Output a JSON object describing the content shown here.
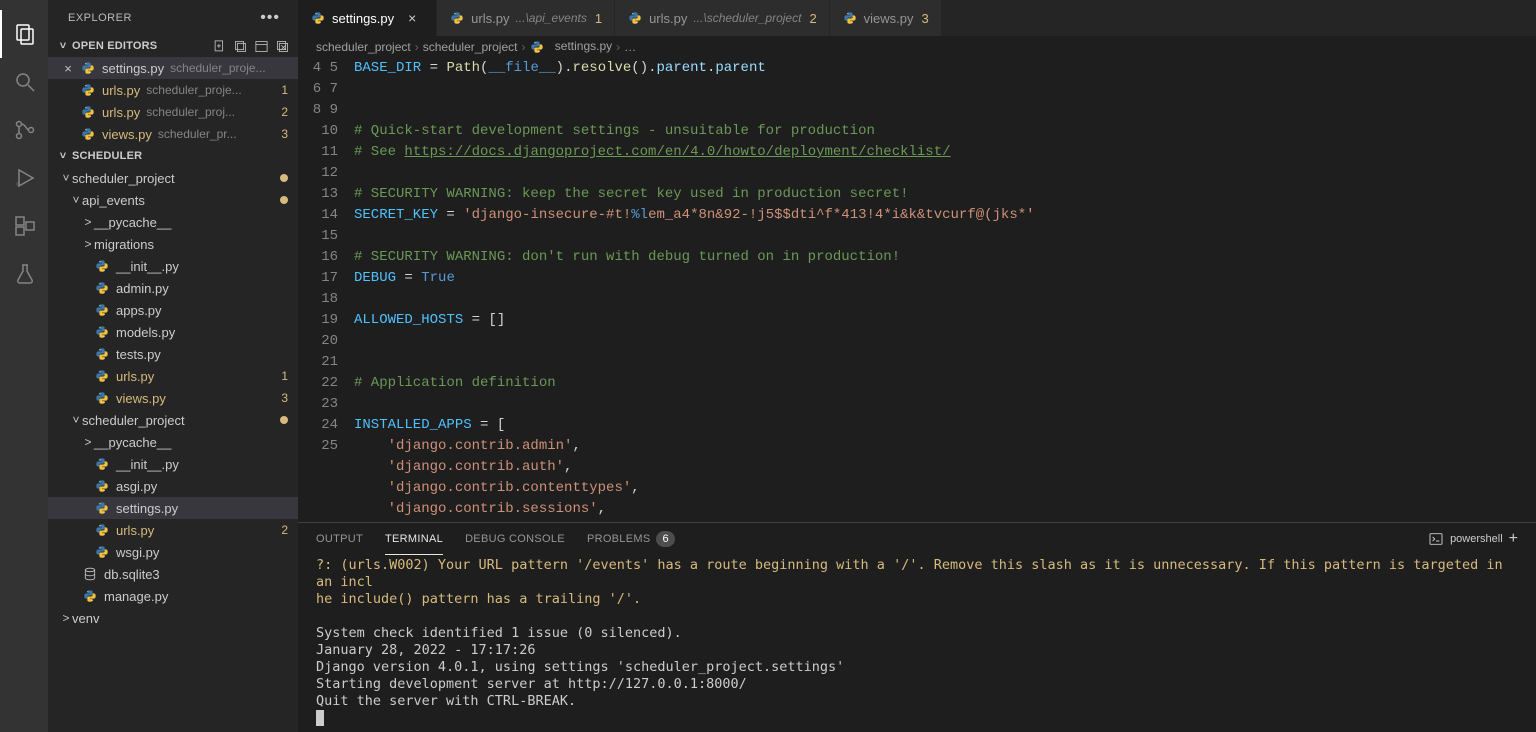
{
  "activitybar": {
    "items": [
      "files",
      "search",
      "git",
      "debug",
      "extensions",
      "testing"
    ]
  },
  "explorer": {
    "title": "EXPLORER",
    "openEditorsLabel": "OPEN EDITORS",
    "openEditors": [
      {
        "name": "settings.py",
        "hint": "scheduler_proje...",
        "badge": "",
        "active": true
      },
      {
        "name": "urls.py",
        "hint": "scheduler_proje...",
        "badge": "1",
        "active": false
      },
      {
        "name": "urls.py",
        "hint": "scheduler_proj...",
        "badge": "2",
        "active": false
      },
      {
        "name": "views.py",
        "hint": "scheduler_pr...",
        "badge": "3",
        "active": false
      }
    ],
    "workspaceLabel": "SCHEDULER",
    "tree": [
      {
        "d": 0,
        "twist": "˅",
        "name": "scheduler_project",
        "type": "folder",
        "dot": true
      },
      {
        "d": 1,
        "twist": "˅",
        "name": "api_events",
        "type": "folder",
        "dot": true
      },
      {
        "d": 2,
        "twist": ">",
        "name": "__pycache__",
        "type": "folder"
      },
      {
        "d": 2,
        "twist": ">",
        "name": "migrations",
        "type": "folder"
      },
      {
        "d": 2,
        "name": "__init__.py",
        "type": "py"
      },
      {
        "d": 2,
        "name": "admin.py",
        "type": "py"
      },
      {
        "d": 2,
        "name": "apps.py",
        "type": "py"
      },
      {
        "d": 2,
        "name": "models.py",
        "type": "py"
      },
      {
        "d": 2,
        "name": "tests.py",
        "type": "py"
      },
      {
        "d": 2,
        "name": "urls.py",
        "type": "py",
        "mod": true,
        "num": "1"
      },
      {
        "d": 2,
        "name": "views.py",
        "type": "py",
        "mod": true,
        "num": "3"
      },
      {
        "d": 1,
        "twist": "˅",
        "name": "scheduler_project",
        "type": "folder",
        "dot": true
      },
      {
        "d": 2,
        "twist": ">",
        "name": "__pycache__",
        "type": "folder"
      },
      {
        "d": 2,
        "name": "__init__.py",
        "type": "py"
      },
      {
        "d": 2,
        "name": "asgi.py",
        "type": "py"
      },
      {
        "d": 2,
        "name": "settings.py",
        "type": "py",
        "sel": true
      },
      {
        "d": 2,
        "name": "urls.py",
        "type": "py",
        "mod": true,
        "num": "2"
      },
      {
        "d": 2,
        "name": "wsgi.py",
        "type": "py"
      },
      {
        "d": 1,
        "name": "db.sqlite3",
        "type": "db"
      },
      {
        "d": 1,
        "name": "manage.py",
        "type": "py"
      },
      {
        "d": 0,
        "twist": ">",
        "name": "venv",
        "type": "folder"
      }
    ]
  },
  "tabs": [
    {
      "name": "settings.py",
      "active": true,
      "close": true
    },
    {
      "name": "urls.py",
      "hint": "...\\api_events",
      "num": "1"
    },
    {
      "name": "urls.py",
      "hint": "...\\scheduler_project",
      "num": "2"
    },
    {
      "name": "views.py",
      "num": "3"
    }
  ],
  "breadcrumb": [
    "scheduler_project",
    "scheduler_project",
    "settings.py",
    "…"
  ],
  "code": {
    "start": 4,
    "lines": [
      {
        "n": 4,
        "seg": [
          [
            "var",
            "BASE_DIR"
          ],
          [
            "op",
            " = "
          ],
          [
            "func",
            "Path"
          ],
          [
            "op",
            "("
          ],
          [
            "const",
            "__file__"
          ],
          [
            "op",
            ")."
          ],
          [
            "func",
            "resolve"
          ],
          [
            "op",
            "()."
          ],
          [
            "prop",
            "parent"
          ],
          [
            "op",
            "."
          ],
          [
            "prop",
            "parent"
          ]
        ]
      },
      {
        "n": 5,
        "seg": []
      },
      {
        "n": 6,
        "seg": []
      },
      {
        "n": 7,
        "seg": [
          [
            "cmt",
            "# Quick-start development settings - unsuitable for production"
          ]
        ]
      },
      {
        "n": 8,
        "seg": [
          [
            "cmt",
            "# See "
          ],
          [
            "link",
            "https://docs.djangoproject.com/en/4.0/howto/deployment/checklist/"
          ]
        ]
      },
      {
        "n": 9,
        "seg": []
      },
      {
        "n": 10,
        "seg": [
          [
            "cmt",
            "# SECURITY WARNING: keep the secret key used in production secret!"
          ]
        ]
      },
      {
        "n": 11,
        "seg": [
          [
            "var",
            "SECRET_KEY"
          ],
          [
            "op",
            " = "
          ],
          [
            "str",
            "'django-insecure-#t!"
          ],
          [
            "esc",
            "%l"
          ],
          [
            "str",
            "em_a4*8n&92-!j5$$dti^f*413!4*i&k&tvcurf@(jks*'"
          ]
        ]
      },
      {
        "n": 12,
        "seg": []
      },
      {
        "n": 13,
        "seg": [
          [
            "cmt",
            "# SECURITY WARNING: don't run with debug turned on in production!"
          ]
        ]
      },
      {
        "n": 14,
        "seg": [
          [
            "var",
            "DEBUG"
          ],
          [
            "op",
            " = "
          ],
          [
            "const",
            "True"
          ]
        ]
      },
      {
        "n": 15,
        "seg": []
      },
      {
        "n": 16,
        "seg": [
          [
            "var",
            "ALLOWED_HOSTS"
          ],
          [
            "op",
            " = []"
          ]
        ]
      },
      {
        "n": 17,
        "seg": []
      },
      {
        "n": 18,
        "seg": []
      },
      {
        "n": 19,
        "seg": [
          [
            "cmt",
            "# Application definition"
          ]
        ]
      },
      {
        "n": 20,
        "seg": []
      },
      {
        "n": 21,
        "seg": [
          [
            "var",
            "INSTALLED_APPS"
          ],
          [
            "op",
            " = ["
          ]
        ]
      },
      {
        "n": 22,
        "seg": [
          [
            "op",
            "    "
          ],
          [
            "str",
            "'django.contrib.admin'"
          ],
          [
            "op",
            ","
          ]
        ]
      },
      {
        "n": 23,
        "seg": [
          [
            "op",
            "    "
          ],
          [
            "str",
            "'django.contrib.auth'"
          ],
          [
            "op",
            ","
          ]
        ]
      },
      {
        "n": 24,
        "seg": [
          [
            "op",
            "    "
          ],
          [
            "str",
            "'django.contrib.contenttypes'"
          ],
          [
            "op",
            ","
          ]
        ]
      },
      {
        "n": 25,
        "seg": [
          [
            "op",
            "    "
          ],
          [
            "str",
            "'django.contrib.sessions'"
          ],
          [
            "op",
            ","
          ]
        ]
      }
    ]
  },
  "panel": {
    "tabs": [
      "OUTPUT",
      "TERMINAL",
      "DEBUG CONSOLE",
      "PROBLEMS"
    ],
    "active": 1,
    "problemsCount": "6",
    "shell": "powershell",
    "warn": "?: (urls.W002) Your URL pattern '/events' has a route beginning with a '/'. Remove this slash as it is unnecessary. If this pattern is targeted in an incl\nhe include() pattern has a trailing '/'.",
    "body": "System check identified 1 issue (0 silenced).\nJanuary 28, 2022 - 17:17:26\nDjango version 4.0.1, using settings 'scheduler_project.settings'\nStarting development server at http://127.0.0.1:8000/\nQuit the server with CTRL-BREAK."
  }
}
